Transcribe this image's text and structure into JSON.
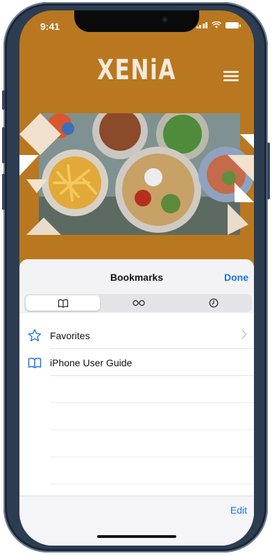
{
  "status_bar": {
    "time": "9:41"
  },
  "website": {
    "logo_text": "XENiA"
  },
  "bookmarks_sheet": {
    "title": "Bookmarks",
    "done_label": "Done",
    "segments": [
      {
        "icon": "book-icon",
        "active": true
      },
      {
        "icon": "reading-list-icon",
        "active": false
      },
      {
        "icon": "history-icon",
        "active": false
      }
    ],
    "items": [
      {
        "label": "Favorites",
        "icon": "star-icon",
        "has_chevron": true
      },
      {
        "label": "iPhone User Guide",
        "icon": "book-icon",
        "has_chevron": false
      }
    ],
    "edit_label": "Edit"
  },
  "colors": {
    "site_background": "#b9771f",
    "accent_blue": "#1a73e8"
  }
}
